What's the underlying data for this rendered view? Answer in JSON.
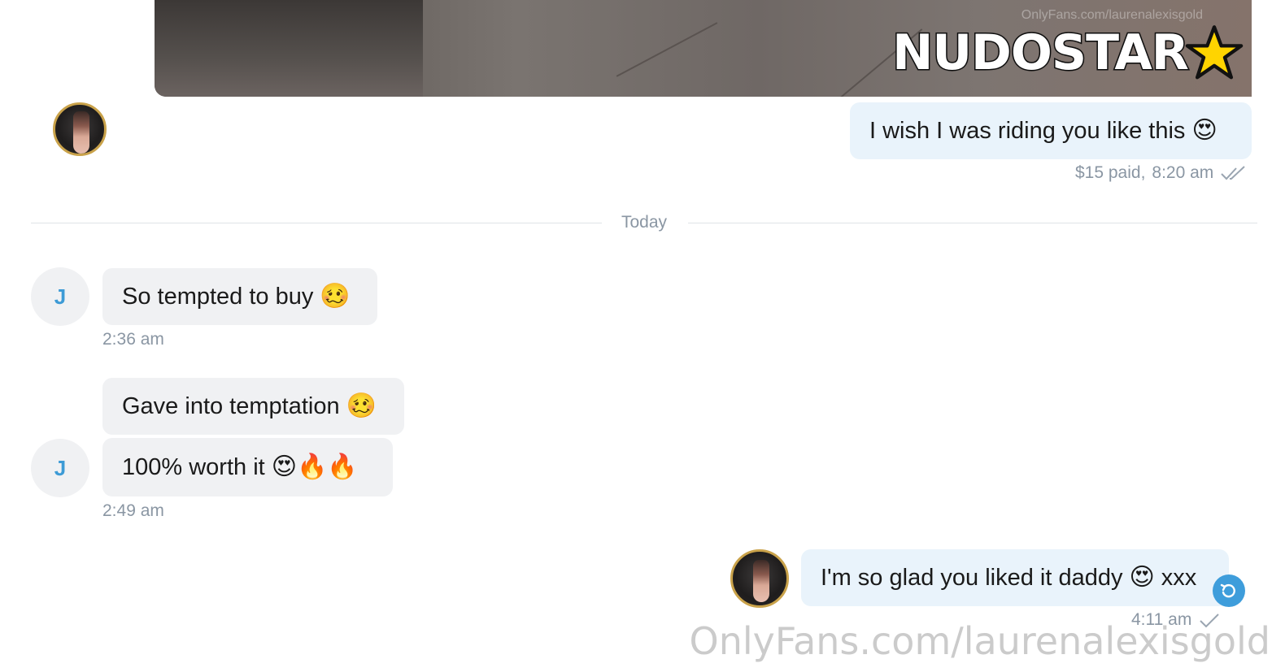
{
  "media": {
    "watermark_small": "OnlyFans.com/laurenalexisgold",
    "logo_text": "NUDOSTAR",
    "logo_icon": "star-icon"
  },
  "messages_top": {
    "outgoing_text": "I wish I was riding you like this",
    "outgoing_emoji": "😍",
    "paid_label": "$15 paid,",
    "time": "8:20 am",
    "status_icon": "double-check-icon"
  },
  "divider": {
    "label": "Today"
  },
  "incoming": {
    "sender_initial": "J",
    "msg1": {
      "text": "So tempted to buy",
      "emoji": "🥴",
      "time": "2:36 am"
    },
    "msg2": {
      "text": "Gave into temptation",
      "emoji": "🥴"
    },
    "msg3": {
      "text": "100% worth it",
      "emojis": "😍🔥🔥",
      "time": "2:49 am"
    }
  },
  "reply": {
    "text": "I'm so glad you liked it daddy",
    "emoji": "😍",
    "suffix": "xxx",
    "time": "4:11 am",
    "status_icon": "single-check-icon",
    "undo_icon": "undo-icon"
  },
  "footer": {
    "watermark": "OnlyFans.com/laurenalexisgold"
  },
  "colors": {
    "incoming_bubble": "#f0f1f3",
    "outgoing_bubble": "#e9f3fb",
    "meta_text": "#8a96a3",
    "accent": "#3e9ddb",
    "avatar_border": "#c9a24a"
  }
}
